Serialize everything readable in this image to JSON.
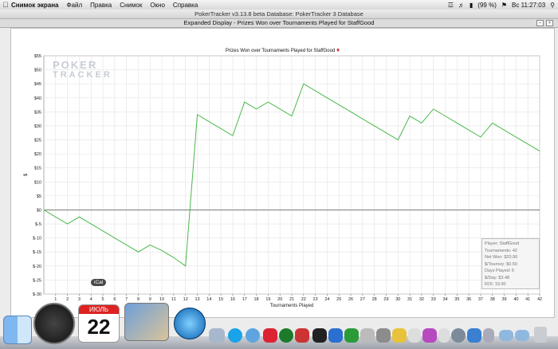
{
  "menubar": {
    "app_name": "Снимок экрана",
    "items": [
      "Файл",
      "Правка",
      "Снимок",
      "Окно",
      "Справка"
    ],
    "battery": "(99 %)",
    "clock": "Вс 11:27:03"
  },
  "window": {
    "title": "PokerTracker v3.13.8 beta   Database: PokerTracker 3 Database",
    "subtitle": "Expanded Display - Prizes Won over Tournaments Played for StaffGood",
    "logo_line1": "POKER",
    "logo_line2": "TRACKER"
  },
  "chart_data": {
    "type": "line",
    "title": "Prizes Won over Tournaments Played for StaffGood",
    "xlabel": "Tournaments Played",
    "ylabel": "$",
    "x": [
      0,
      1,
      2,
      3,
      4,
      5,
      6,
      7,
      8,
      9,
      10,
      11,
      12,
      13,
      14,
      15,
      16,
      17,
      18,
      19,
      20,
      21,
      22,
      23,
      24,
      25,
      26,
      27,
      28,
      29,
      30,
      31,
      32,
      33,
      34,
      35,
      36,
      37,
      38,
      39,
      40,
      41,
      42
    ],
    "series": [
      {
        "values": [
          0,
          -2.5,
          -5,
          -2.5,
          -5,
          -7.5,
          -10,
          -12.5,
          -15,
          -12.5,
          -14.5,
          -17,
          -20,
          34,
          31.5,
          29,
          26.5,
          38.5,
          36,
          38.5,
          36,
          33.5,
          45,
          42.5,
          40,
          37.5,
          35,
          32.5,
          30,
          27.5,
          25,
          33.5,
          31,
          36,
          33.5,
          31,
          28.5,
          26,
          31,
          28.5,
          26,
          23.5,
          21
        ],
        "color": "#4cb84c"
      }
    ],
    "xlim": [
      0,
      42
    ],
    "ylim": [
      -30,
      55
    ],
    "yticks": [
      55,
      50,
      45,
      40,
      35,
      30,
      25,
      20,
      15,
      10,
      5,
      0,
      -5,
      -10,
      -15,
      -20,
      -25,
      -30
    ],
    "ytick_labels": [
      "$55",
      "$50",
      "$45",
      "$40",
      "$35",
      "$30",
      "$25",
      "$20",
      "$15",
      "$10",
      "$5",
      "$0",
      "$-5",
      "$-10",
      "$-15",
      "$-20",
      "$-25",
      "$-30"
    ],
    "xticks": [
      1,
      2,
      3,
      4,
      5,
      6,
      7,
      8,
      9,
      10,
      11,
      12,
      13,
      14,
      15,
      16,
      17,
      18,
      19,
      20,
      21,
      22,
      23,
      24,
      25,
      26,
      27,
      28,
      29,
      30,
      31,
      32,
      33,
      34,
      35,
      36,
      37,
      38,
      39,
      40,
      41,
      42
    ],
    "zero_line": true,
    "grid": true
  },
  "stats": {
    "player": "Player: StaffGood",
    "tournaments": "Tournaments: 42",
    "net_won": "Net Won: $20.90",
    "per_tourney": "$/Tourney: $0.50",
    "days_played": "Days Played: 6",
    "per_day": "$/Day: $3.48",
    "roi": "ROI: 19.90"
  },
  "dock": {
    "ical_label": "iCal",
    "calendar_month": "ИЮЛЬ",
    "calendar_day": "22"
  }
}
